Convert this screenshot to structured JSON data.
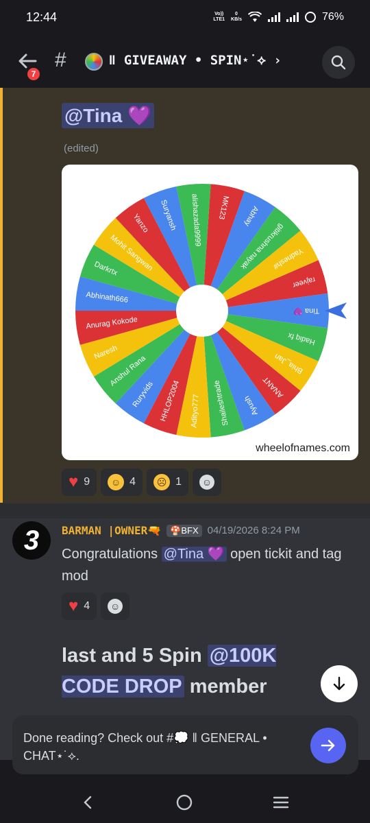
{
  "status_bar": {
    "time": "12:44",
    "volte": "Vo))",
    "lte": "LTE1",
    "speed_value": "0",
    "speed_unit": "KB/s",
    "battery": "76%"
  },
  "header": {
    "unread_badge": "7",
    "hash": "#",
    "channel_name": "ǁ GIVEAWAY • SPIN⋆˙⟡ ›"
  },
  "giveaway_post": {
    "mention": "@Tina 💜",
    "edited": "(edited)",
    "wheel": {
      "brand": "wheelofnames.com",
      "selected": "Tina 💜",
      "segment_colors": [
        "#db3236",
        "#4885ed",
        "#3cba54",
        "#f4c20d"
      ],
      "entries": [
        "MK123",
        "Abhay",
        "gitikrushna nayak",
        "Yadnesh#",
        "rajveer",
        "Tina 💜",
        "Hadiq fx",
        "Bhia_Jan",
        "ANANT",
        "Ayush",
        "Shaileshtrade",
        "Adityo777",
        "HHLOP2004",
        "Ruryvids",
        "Anshul Rana",
        "Naresh",
        "Anurag Kokode",
        "Abhinath666",
        "Darkrtx",
        "Mohit Sangwan",
        "Yanzo",
        "Suryansh",
        "alishazada9999"
      ]
    },
    "reactions": [
      {
        "emoji": "heart-emoji",
        "count": "9"
      },
      {
        "emoji": "saluting-face-emoji",
        "count": "4"
      },
      {
        "emoji": "crying-face-emoji",
        "count": "1"
      }
    ]
  },
  "message": {
    "avatar_letter": "3",
    "author": "BARMAN |OWNER",
    "author_emoji": "🔫",
    "tag_emoji": "🍄",
    "tag": "BFX",
    "timestamp": "04/19/2026 8:24 PM",
    "text_before": "Congratulations ",
    "mention": "@Tina 💜",
    "text_after": " open tickit and tag mod",
    "reactions": [
      {
        "emoji": "heart-emoji",
        "count": "4"
      }
    ]
  },
  "big_message": {
    "text_before": "last and 5  Spin ",
    "mention": "@100K CODE DROP",
    "text_after": " member"
  },
  "next_channel_banner": {
    "text": "Done reading? Check out #💭 ǁ GENERAL • CHAT⋆˙⟡."
  }
}
